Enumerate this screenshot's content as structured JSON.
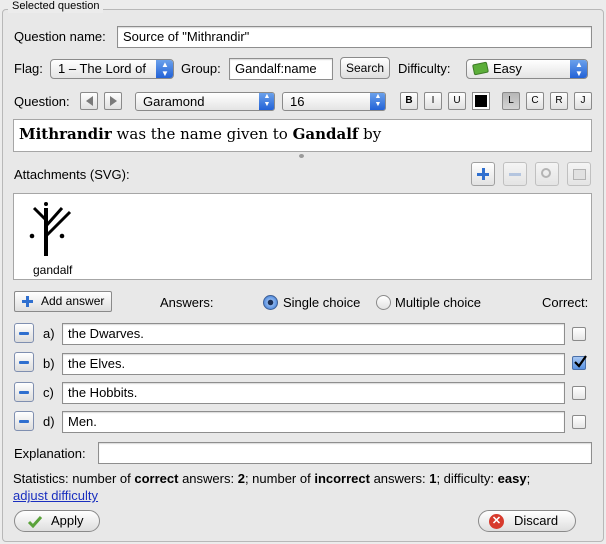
{
  "group_title": "Selected question",
  "question_name": {
    "label": "Question name:",
    "value": "Source of \"Mithrandir\""
  },
  "flag": {
    "label": "Flag:",
    "value": "1 – The Lord of"
  },
  "group": {
    "label": "Group:",
    "value": "Gandalf:name",
    "search_label": "Search"
  },
  "difficulty": {
    "label": "Difficulty:",
    "value": "Easy",
    "color": "#5cae3a"
  },
  "format": {
    "label": "Question:",
    "font": "Garamond",
    "size": "16",
    "bold": "B",
    "italic": "I",
    "underline": "U",
    "align_left": "L",
    "align_center": "C",
    "align_right": "R",
    "align_justify": "J",
    "text_color": "#000000"
  },
  "question_text": {
    "b1": "Mithrandir",
    "t1": " was the name given to ",
    "b2": "Gandalf",
    "t2": " by"
  },
  "attachments": {
    "label": "Attachments (SVG):",
    "items": [
      {
        "name": "gandalf",
        "icon": "gandalf-rune-icon"
      }
    ]
  },
  "answers_header": {
    "add_label": "Add answer",
    "answers_label": "Answers:",
    "single_choice": "Single choice",
    "multiple_choice": "Multiple choice",
    "correct_label": "Correct:",
    "mode": "single"
  },
  "answers": [
    {
      "letter": "a)",
      "text": "the Dwarves.",
      "correct": false
    },
    {
      "letter": "b)",
      "text": "the Elves.",
      "correct": true
    },
    {
      "letter": "c)",
      "text": "the Hobbits.",
      "correct": false
    },
    {
      "letter": "d)",
      "text": "Men.",
      "correct": false
    }
  ],
  "explanation": {
    "label": "Explanation:",
    "value": ""
  },
  "statistics": {
    "p1": "Statistics: number of ",
    "b1": "correct",
    "p2": " answers: ",
    "correct_count": "2",
    "p3": "; number of ",
    "b2": "incorrect",
    "p4": " answers: ",
    "incorrect_count": "1",
    "p5": "; difficulty: ",
    "difficulty": "easy",
    "p6": ";",
    "adjust_link": "adjust difficulty"
  },
  "apply_label": "Apply",
  "discard_label": "Discard"
}
